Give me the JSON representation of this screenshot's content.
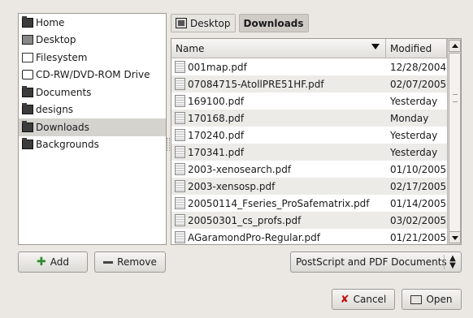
{
  "places": [
    {
      "label": "Home",
      "icon": "folder-icon"
    },
    {
      "label": "Desktop",
      "icon": "desktop-icon"
    },
    {
      "label": "Filesystem",
      "icon": "filesystem-icon"
    },
    {
      "label": "CD-RW/DVD-ROM Drive",
      "icon": "cdrom-icon"
    },
    {
      "label": "Documents",
      "icon": "folder-icon"
    },
    {
      "label": "designs",
      "icon": "folder-icon"
    },
    {
      "label": "Downloads",
      "icon": "folder-icon",
      "selected": true
    },
    {
      "label": "Backgrounds",
      "icon": "folder-icon"
    }
  ],
  "buttons": {
    "add_label": "Add",
    "remove_label": "Remove",
    "cancel_label": "Cancel",
    "open_label": "Open"
  },
  "pathbar": {
    "crumbs": [
      {
        "label": "Desktop",
        "active": false
      },
      {
        "label": "Downloads",
        "active": true
      }
    ]
  },
  "filelist": {
    "columns": {
      "name": "Name",
      "modified": "Modified"
    },
    "rows": [
      {
        "name": "001map.pdf",
        "modified": "12/28/2004"
      },
      {
        "name": "07084715-AtollPRE51HF.pdf",
        "modified": "02/07/2005"
      },
      {
        "name": "169100.pdf",
        "modified": "Yesterday"
      },
      {
        "name": "170168.pdf",
        "modified": "Monday"
      },
      {
        "name": "170240.pdf",
        "modified": "Yesterday"
      },
      {
        "name": "170341.pdf",
        "modified": "Yesterday"
      },
      {
        "name": "2003-xenosearch.pdf",
        "modified": "01/10/2005"
      },
      {
        "name": "2003-xensosp.pdf",
        "modified": "02/17/2005"
      },
      {
        "name": "20050114_Fseries_ProSafematrix.pdf",
        "modified": "01/14/2005"
      },
      {
        "name": "20050301_cs_profs.pdf",
        "modified": "03/02/2005"
      },
      {
        "name": "AGaramondPro-Regular.pdf",
        "modified": "01/21/2005"
      }
    ]
  },
  "filter": {
    "selected": "PostScript and PDF Documents"
  }
}
